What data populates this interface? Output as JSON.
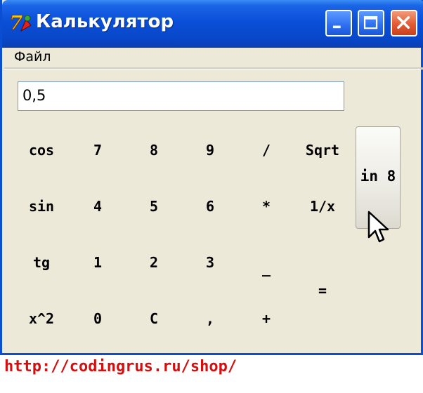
{
  "window": {
    "title": "Калькулятор",
    "menu": [
      "Файл"
    ]
  },
  "display": {
    "value": "0,5"
  },
  "keys": {
    "cos": "cos",
    "k7": "7",
    "k8": "8",
    "k9": "9",
    "div": "/",
    "sqrt": "Sqrt",
    "sin": "sin",
    "k4": "4",
    "k5": "5",
    "k6": "6",
    "mul": "*",
    "inv": "1/x",
    "tg": "tg",
    "k1": "1",
    "k2": "2",
    "k3": "3",
    "minus": "_",
    "sq": "x^2",
    "k0": "0",
    "clear": "C",
    "comma": ",",
    "plus": "+",
    "equals": "=",
    "in8": "in 8"
  },
  "footer": {
    "link": "http://codingrus.ru/shop/"
  },
  "icons": {
    "app": "app-logo-icon",
    "cursor": "mouse-pointer-icon"
  },
  "colors": {
    "title_bar": "#0a4fd8",
    "window_bg": "#ece9d8",
    "close_button": "#e35a33",
    "link": "#d21010"
  }
}
